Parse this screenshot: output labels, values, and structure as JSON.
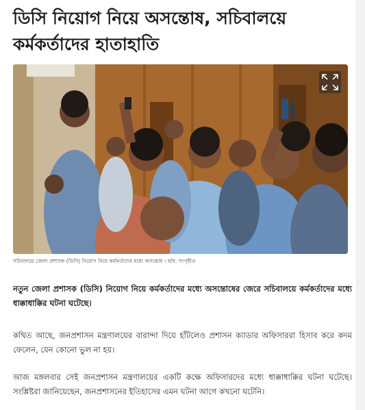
{
  "article": {
    "headline": "ডিসি নিয়োগ নিয়ে অসন্তোষ, সচিবালয়ে কর্মকর্তাদের হাতাহাতি",
    "photo": {
      "icon": "fullscreen-icon",
      "caption": "সচিবালয়ে জেলা প্রশাসক (ডিসি) নিয়োগ নিয়ে কর্মকর্তাদের মধ্যে অসন্তোষ । ছবি: সংগৃহীত"
    },
    "lead": "নতুন জেলা প্রশাসক (ডিসি) নিয়োগ নিয়ে কর্মকর্তাদের মধ্যে অসন্তোষের জেরে সচিবালয়ে কর্মকর্তাদের মধ্যে ধাক্কাধাক্কির ঘটনা ঘটেছে।",
    "paragraphs": [
      "কথিত আছে, জনপ্রশাসন মন্ত্রণালয়ের বারান্দা দিয়ে হাঁটলেও প্রশাসন ক্যাডার অফিসাররা হিসাব করে কদম ফেলেন, যেন কোনো ভুল না হয়।",
      "আজ মঙ্গলবার সেই জনপ্রশাসন মন্ত্রণালয়ের একটি কক্ষে অফিসারদের মধ্যে ধাক্কাধাক্কির ঘটনা ঘটেছে। সংশ্লিষ্টরা জানিয়েছেন, জনপ্রশাসনের ইতিহাসের এমন ঘটনা আগে কখনো ঘটেনি।"
    ]
  }
}
